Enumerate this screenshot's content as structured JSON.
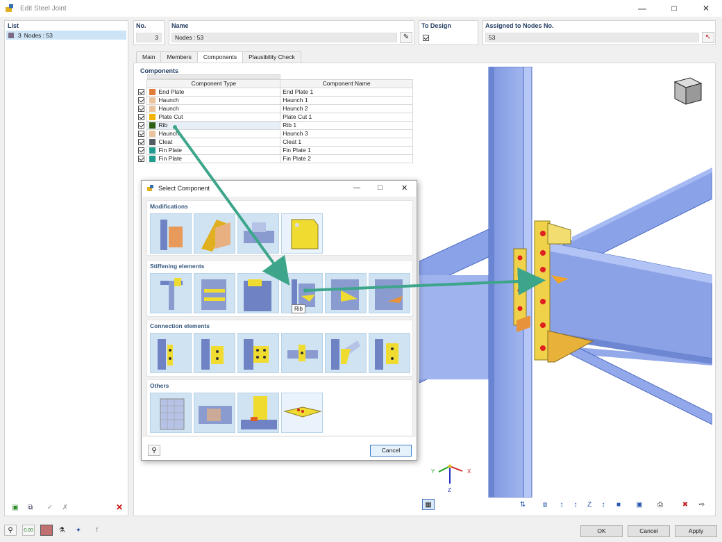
{
  "window": {
    "title": "Edit Steel Joint"
  },
  "list": {
    "header": "List",
    "items": [
      {
        "no": "3",
        "label": "Nodes : 53"
      }
    ]
  },
  "no": {
    "label": "No.",
    "value": "3"
  },
  "name": {
    "label": "Name",
    "value": "Nodes : 53"
  },
  "to_design": {
    "label": "To Design",
    "checked": true
  },
  "assigned": {
    "label": "Assigned to Nodes No.",
    "value": "53"
  },
  "tabs": [
    "Main",
    "Members",
    "Components",
    "Plausibility Check"
  ],
  "components": {
    "header": "Components",
    "col_type": "Component Type",
    "col_name": "Component Name",
    "rows": [
      {
        "type": "End Plate",
        "name": "End Plate 1",
        "color": "#e07b39"
      },
      {
        "type": "Haunch",
        "name": "Haunch 1",
        "color": "#e8c39e"
      },
      {
        "type": "Haunch",
        "name": "Haunch 2",
        "color": "#e8c39e"
      },
      {
        "type": "Plate Cut",
        "name": "Plate Cut 1",
        "color": "#f2b400"
      },
      {
        "type": "Rib",
        "name": "Rib 1",
        "color": "#2e5e12"
      },
      {
        "type": "Haunch",
        "name": "Haunch 3",
        "color": "#e8c39e"
      },
      {
        "type": "Cleat",
        "name": "Cleat 1",
        "color": "#555a60"
      },
      {
        "type": "Fin Plate",
        "name": "Fin Plate 1",
        "color": "#1f9c8e"
      },
      {
        "type": "Fin Plate",
        "name": "Fin Plate 2",
        "color": "#1f9c8e"
      }
    ]
  },
  "dialog": {
    "title": "Select Component",
    "sections": [
      "Modifications",
      "Stiffening elements",
      "Connection elements",
      "Others"
    ],
    "tooltip": "Rib",
    "cancel": "Cancel"
  },
  "axes": {
    "x": "X",
    "y": "Y",
    "z": "Z"
  },
  "footer": {
    "ok": "OK",
    "cancel": "Cancel",
    "apply": "Apply"
  },
  "colors": {
    "accent": "#3da58a",
    "steel_blue": "#8aa2e8",
    "yellow_plate": "#f0d24a",
    "bolt": "#e02020"
  }
}
